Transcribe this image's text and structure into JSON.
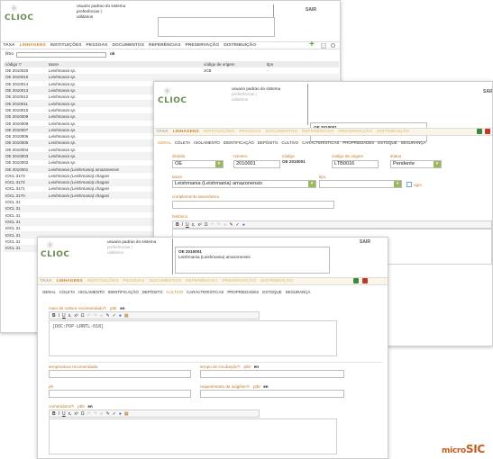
{
  "brand": {
    "name": "CLIOC",
    "footer_prefix": "micro",
    "footer_suffix": "SIC"
  },
  "user_menu": {
    "line1": "usuario padrao do sistema",
    "line2": "preferências |",
    "line3": "utilitários"
  },
  "logout": "SAIR",
  "win1": {
    "menu": [
      "TAXA",
      "LINHAGENS",
      "INSTITUIÇÕES",
      "PESSOAS",
      "DOCUMENTOS",
      "REFERÊNCIAS",
      "PRESERVAÇÃO",
      "DISTRIBUIÇÃO"
    ],
    "filter_label": "filtro",
    "filter_value": "",
    "ok_label": "ok",
    "columns": [
      "código",
      "taxon",
      "código de origem",
      "tipo"
    ],
    "rows": [
      [
        "OE 2010020",
        "Leishmania sp.",
        "JCB",
        "-"
      ],
      [
        "OE 2010015",
        "Leishmania sp.",
        "",
        ""
      ],
      [
        "OE 2010014",
        "Leishmania sp.",
        "",
        ""
      ],
      [
        "OE 2010013",
        "Leishmania sp.",
        "",
        ""
      ],
      [
        "OE 2010012",
        "Leishmania sp.",
        "",
        ""
      ],
      [
        "OE 2010011",
        "Leishmania sp.",
        "",
        ""
      ],
      [
        "OE 2010010",
        "Leishmania sp.",
        "",
        ""
      ],
      [
        "OE 2010009",
        "Leishmania sp.",
        "",
        ""
      ],
      [
        "OE 2010008",
        "Leishmania sp.",
        "",
        ""
      ],
      [
        "OE 2010007",
        "Leishmania sp.",
        "",
        ""
      ],
      [
        "OE 2010006",
        "Leishmania sp.",
        "",
        ""
      ],
      [
        "OE 2010005",
        "Leishmania sp.",
        "",
        ""
      ],
      [
        "OE 2010004",
        "Leishmania sp.",
        "",
        ""
      ],
      [
        "OE 2010003",
        "Leishmania sp.",
        "",
        ""
      ],
      [
        "OE 2010002",
        "Leishmania sp.",
        "",
        ""
      ],
      [
        "OE 2010001",
        "Leishmania (Leishmania) amazonensis",
        "",
        ""
      ],
      [
        "IOCL 3173",
        "Leishmania (Leishmania) chagasi",
        "",
        ""
      ],
      [
        "IOCL 3172",
        "Leishmania (Leishmania) chagasi",
        "",
        ""
      ],
      [
        "IOCL 3171",
        "Leishmania (Leishmania) chagasi",
        "",
        ""
      ],
      [
        "IOCL 3170",
        "Leishmania (Leishmania) chagasi",
        "",
        ""
      ],
      [
        "IOCL 31",
        "",
        "",
        ""
      ],
      [
        "IOCL 31",
        "",
        "",
        ""
      ],
      [
        "IOCL 31",
        "",
        "",
        ""
      ],
      [
        "IOCL 31",
        "",
        "",
        ""
      ],
      [
        "IOCL 31",
        "",
        "",
        ""
      ],
      [
        "IOCL 31",
        "",
        "",
        ""
      ],
      [
        "IOCL 31",
        "",
        "",
        ""
      ],
      [
        "IOCL 31",
        "",
        "",
        ""
      ]
    ]
  },
  "record": {
    "code": "OE 2010001",
    "taxon": "Leishmania (Leishmania) amazonensis"
  },
  "win2": {
    "menu": [
      "TAXA",
      "LINHAGENS",
      "INSTITUIÇÕES",
      "PESSOAS",
      "DOCUMENTOS",
      "REFERÊNCIAS",
      "PRESERVAÇÃO",
      "DISTRIBUIÇÃO"
    ],
    "tabs": [
      "GERAL",
      "COLETA",
      "ISOLAMENTO",
      "IDENTIFICAÇÃO",
      "DEPÓSITO",
      "CULTIVO",
      "CARACTERÍSTICAS",
      "PROPRIEDADES",
      "ESTOQUE",
      "SEGURANÇA"
    ],
    "labels": {
      "division": "divisão",
      "number": "número",
      "code": "código",
      "origin_code": "código de origem",
      "status": "status",
      "taxon": "taxon",
      "type": "tipo",
      "complement": "complemento taxonômico",
      "history": "histórico",
      "ogm": "ogm"
    },
    "values": {
      "division": "OE",
      "number": "2010001",
      "code": "OE 2010001",
      "origin_code": "LTB0016",
      "status": "Pendente",
      "taxon": "Leishmania (Leishmania) amazonensis"
    }
  },
  "win3": {
    "menu": [
      "TAXA",
      "LINHAGENS",
      "INSTITUIÇÕES",
      "PESSOAS",
      "DOCUMENTOS",
      "REFERÊNCIAS",
      "PRESERVAÇÃO",
      "DISTRIBUIÇÃO"
    ],
    "tabs": [
      "GERAL",
      "COLETA",
      "ISOLAMENTO",
      "IDENTIFICAÇÃO",
      "DEPÓSITO",
      "CULTIVO",
      "CARACTERÍSTICAS",
      "PROPRIEDADES",
      "ESTOQUE",
      "SEGURANÇA"
    ],
    "labels": {
      "culture_medium": "meio de cultura recomendado",
      "lang_ptbr": "ptbr",
      "lang_en": "en",
      "temperature": "temperatura recomendada",
      "incubation": "tempo de incubação",
      "ph": "ph",
      "oxygen": "requerimento de oxigênio",
      "comments": "comentários"
    },
    "culture_medium_text": "[DOC:POP-LRNTL-018]"
  }
}
